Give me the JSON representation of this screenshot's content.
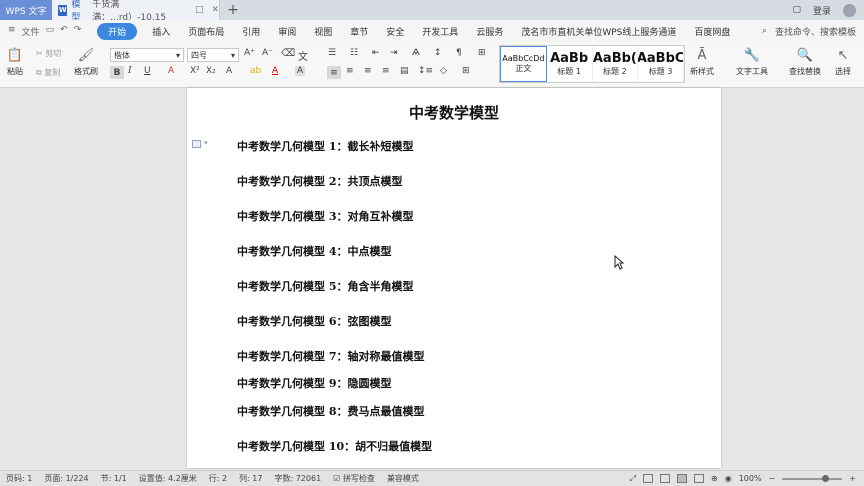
{
  "titlebar": {
    "app_tab": "WPS 文字",
    "doc_icon": "W",
    "doc_name": "模型",
    "doc_subname": "千货满满：...rd）-10.15",
    "login": "登录"
  },
  "ribbon": {
    "tabs": [
      "开始",
      "插入",
      "页面布局",
      "引用",
      "审阅",
      "视图",
      "章节",
      "安全",
      "开发工具",
      "云服务",
      "茂名市市直机关单位WPS线上服务通道",
      "百度网盘"
    ],
    "file_menu": "文件",
    "search_placeholder": "查找命令、搜索模板"
  },
  "toolbar": {
    "paste": "粘贴",
    "cut": "剪切",
    "copy": "复制",
    "format_painter": "格式刷",
    "font_name": "楷体",
    "font_size": "四号",
    "new_style": "新样式",
    "text_tools": "文字工具",
    "find_replace": "查找替换",
    "select": "选择",
    "styles": [
      {
        "sample": "AaBbCcDd",
        "label": "正文"
      },
      {
        "sample": "AaBb",
        "label": "标题 1"
      },
      {
        "sample": "AaBb(",
        "label": "标题 2"
      },
      {
        "sample": "AaBbC",
        "label": "标题 3"
      }
    ]
  },
  "document": {
    "title": "中考数学模型",
    "lines": [
      "中考数学几何模型 1：截长补短模型",
      "中考数学几何模型 2：共顶点模型",
      "中考数学几何模型 3：对角互补模型",
      "中考数学几何模型 4：中点模型",
      "中考数学几何模型 5：角含半角模型",
      "中考数学几何模型 6：弦图模型",
      "中考数学几何模型 7：轴对称最值模型",
      "中考数学几何模型 9：隐圆模型",
      "中考数学几何模型 8：费马点最值模型",
      "中考数学几何模型 10：胡不归最值模型"
    ]
  },
  "statusbar": {
    "page_num": "页码: 1",
    "pages": "页面: 1/224",
    "section": "节: 1/1",
    "position": "设置值: 4.2厘米",
    "row": "行: 2",
    "col": "列: 17",
    "words": "字数: 72061",
    "spell": "拼写检查",
    "compat": "兼容模式",
    "zoom": "100%"
  }
}
